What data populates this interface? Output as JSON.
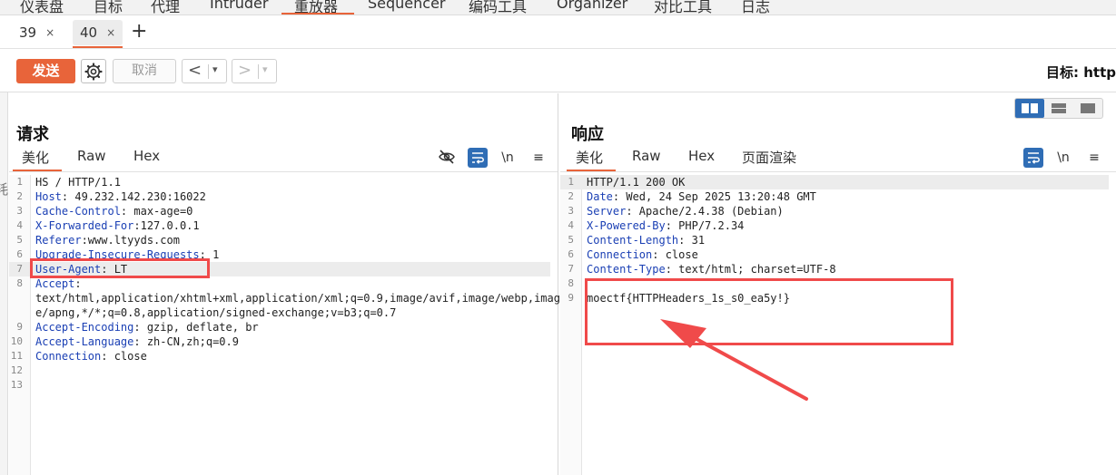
{
  "topnav": {
    "items": [
      "仪表盘",
      "目标",
      "代理",
      "Intruder",
      "重放器",
      "Sequencer",
      "编码工具",
      "Organizer",
      "对比工具",
      "日志"
    ]
  },
  "tabs": [
    {
      "label": "39",
      "close": "×"
    },
    {
      "label": "40",
      "close": "×"
    }
  ],
  "tab_add": "+",
  "toolbar": {
    "send_label": "发送",
    "cancel_label": "取消",
    "back_arrow": "<",
    "forward_arrow": ">",
    "dropdown": "▾",
    "target_label": "目标: http"
  },
  "left_edge_char": "耗",
  "request": {
    "title": "请求",
    "tabs": [
      "美化",
      "Raw",
      "Hex"
    ],
    "newline_label": "\\n",
    "lines": [
      {
        "n": "1",
        "key": "",
        "text": "HS / HTTP/1.1"
      },
      {
        "n": "2",
        "key": "Host",
        "text": ": 49.232.142.230:16022"
      },
      {
        "n": "3",
        "key": "Cache-Control",
        "text": ": max-age=0"
      },
      {
        "n": "4",
        "key": "X-Forwarded-For",
        "text": ":127.0.0.1"
      },
      {
        "n": "5",
        "key": "Referer",
        "text": ":www.ltyyds.com"
      },
      {
        "n": "6",
        "key": "Upgrade-Insecure-Requests",
        "text": ": 1"
      },
      {
        "n": "7",
        "key": "User-Agent",
        "text": ": LT"
      },
      {
        "n": "8",
        "key": "Accept",
        "text": ":"
      },
      {
        "n": "",
        "key": "",
        "text": "text/html,application/xhtml+xml,application/xml;q=0.9,image/avif,image/webp,imag"
      },
      {
        "n": "",
        "key": "",
        "text": "e/apng,*/*;q=0.8,application/signed-exchange;v=b3;q=0.7"
      },
      {
        "n": "9",
        "key": "Accept-Encoding",
        "text": ": gzip, deflate, br"
      },
      {
        "n": "10",
        "key": "Accept-Language",
        "text": ": zh-CN,zh;q=0.9"
      },
      {
        "n": "11",
        "key": "Connection",
        "text": ": close"
      },
      {
        "n": "12",
        "key": "",
        "text": ""
      },
      {
        "n": "13",
        "key": "",
        "text": ""
      }
    ]
  },
  "response": {
    "title": "响应",
    "tabs": [
      "美化",
      "Raw",
      "Hex",
      "页面渲染"
    ],
    "newline_label": "\\n",
    "lines": [
      {
        "n": "1",
        "key": "",
        "text": "HTTP/1.1 200 OK"
      },
      {
        "n": "2",
        "key": "Date",
        "text": ": Wed, 24 Sep 2025 13:20:48 GMT"
      },
      {
        "n": "3",
        "key": "Server",
        "text": ": Apache/2.4.38 (Debian)"
      },
      {
        "n": "4",
        "key": "X-Powered-By",
        "text": ": PHP/7.2.34"
      },
      {
        "n": "5",
        "key": "Content-Length",
        "text": ": 31"
      },
      {
        "n": "6",
        "key": "Connection",
        "text": ": close"
      },
      {
        "n": "7",
        "key": "Content-Type",
        "text": ": text/html; charset=UTF-8"
      },
      {
        "n": "8",
        "key": "",
        "text": ""
      },
      {
        "n": "9",
        "key": "",
        "text": "moectf{HTTPHeaders_1s_s0_ea5y!}"
      }
    ]
  },
  "colors": {
    "accent": "#e8643a",
    "header_key": "#1a3fb4",
    "annotation": "#f04a4a",
    "icon_active": "#2f6db5"
  }
}
